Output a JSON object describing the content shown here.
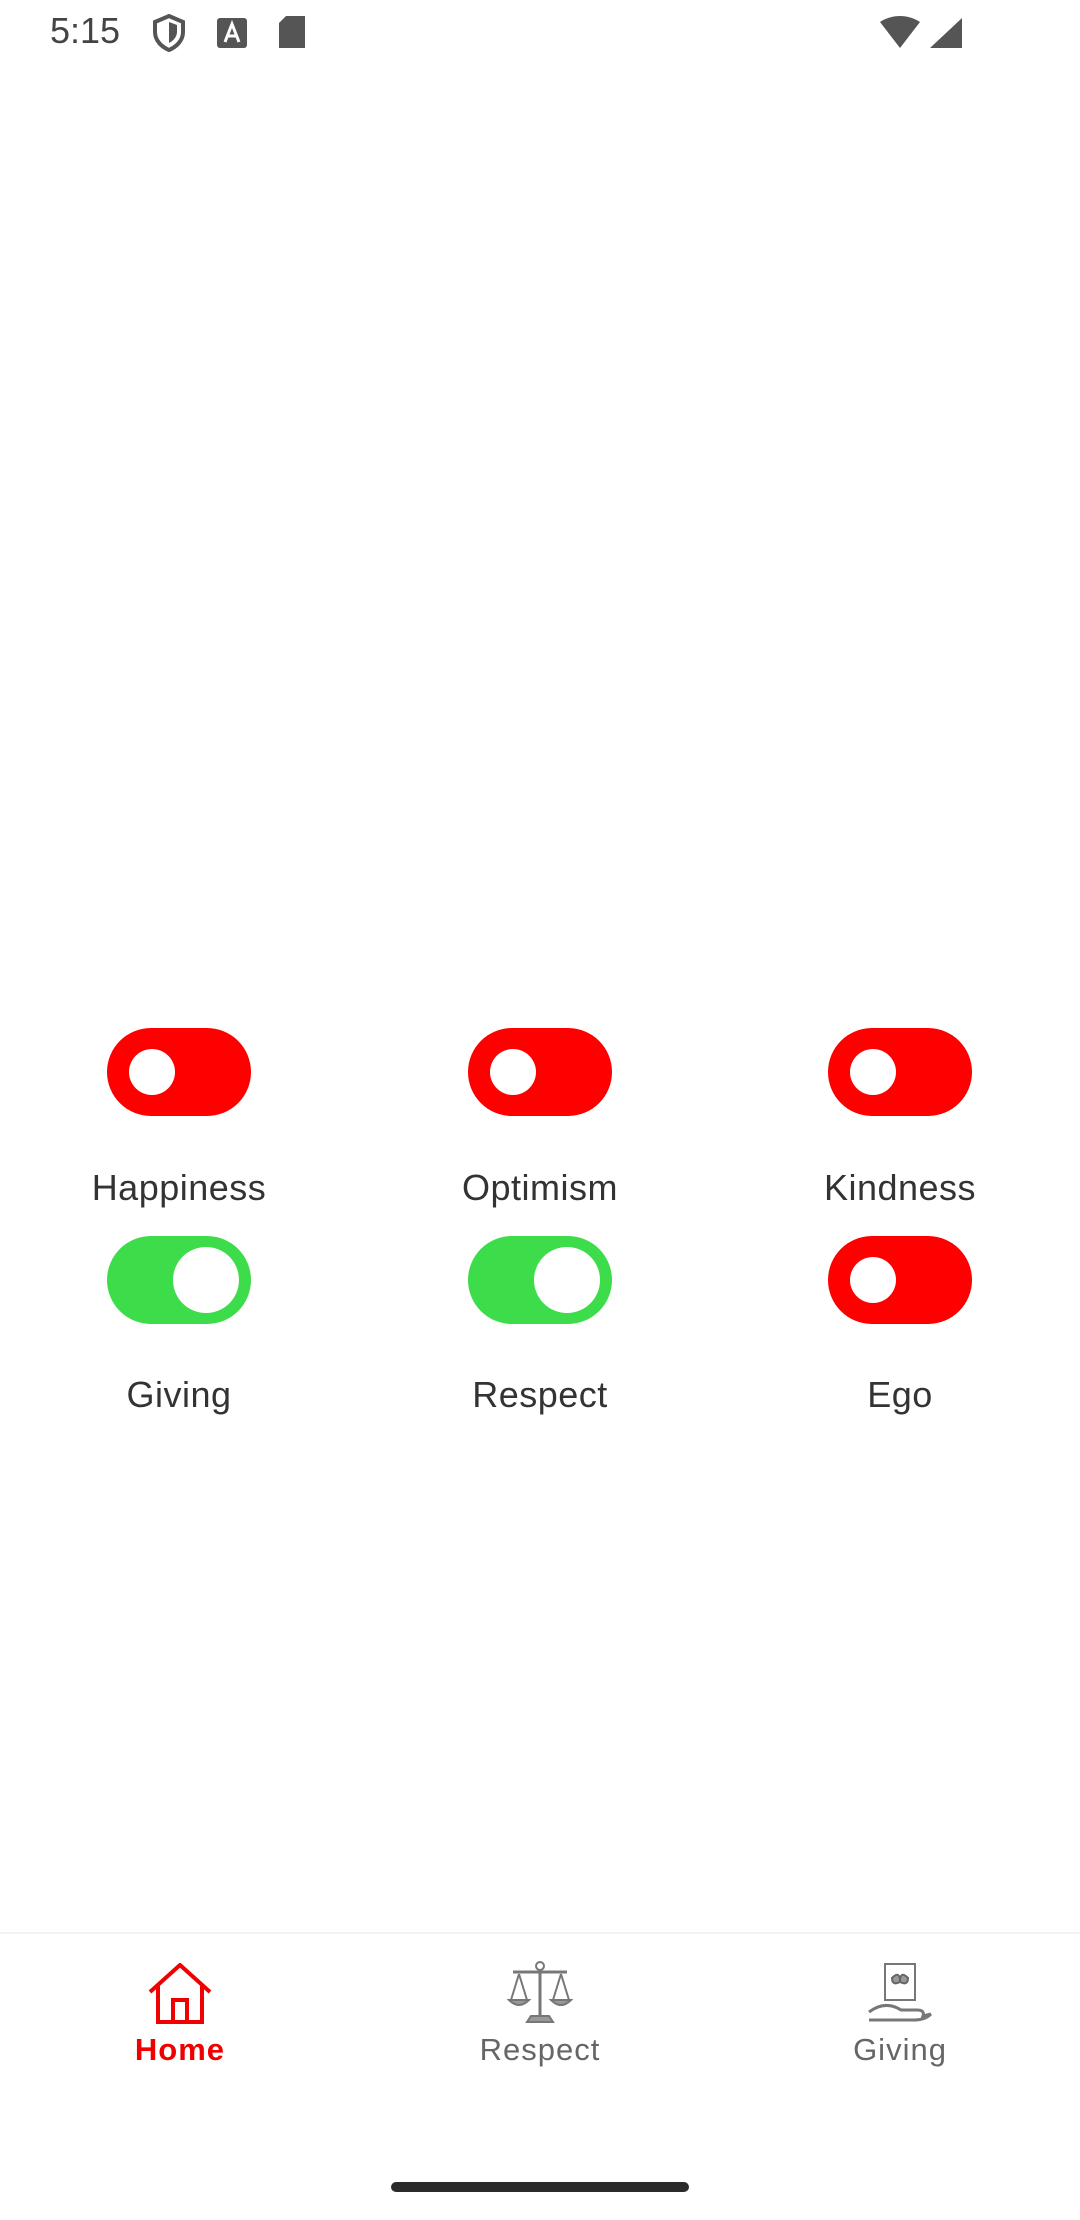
{
  "status_bar": {
    "time": "5:15",
    "icons": [
      "shield-icon",
      "font-icon",
      "sd-card-icon",
      "wifi-icon",
      "signal-icon"
    ]
  },
  "toggles": [
    {
      "label": "Happiness",
      "state": "off"
    },
    {
      "label": "Optimism",
      "state": "off"
    },
    {
      "label": "Kindness",
      "state": "off"
    },
    {
      "label": "Giving",
      "state": "on"
    },
    {
      "label": "Respect",
      "state": "on"
    },
    {
      "label": "Ego",
      "state": "off"
    }
  ],
  "colors": {
    "toggle_off": "#ff0000",
    "toggle_on": "#3ddc4a",
    "nav_active": "#f00000",
    "nav_inactive": "#666666"
  },
  "bottom_nav": {
    "items": [
      {
        "label": "Home",
        "icon": "home-icon",
        "active": true
      },
      {
        "label": "Respect",
        "icon": "scales-icon",
        "active": false
      },
      {
        "label": "Giving",
        "icon": "gift-hand-icon",
        "active": false
      }
    ]
  }
}
